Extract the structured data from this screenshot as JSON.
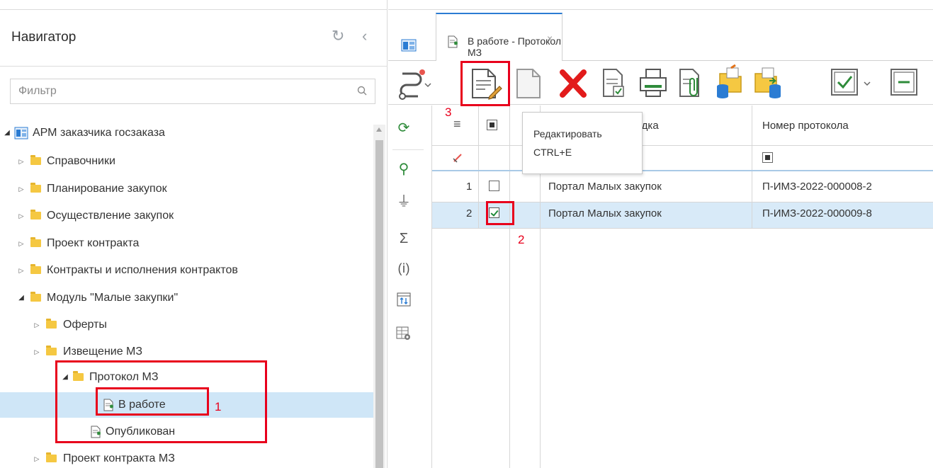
{
  "navigator": {
    "title": "Навигатор",
    "filter_placeholder": "Фильтр",
    "tree": [
      {
        "label": "АРМ заказчика госзаказа",
        "level": 0,
        "expanded": true,
        "icon": "app-icon"
      },
      {
        "label": "Справочники",
        "level": 1,
        "expanded": false,
        "icon": "folder-icon"
      },
      {
        "label": "Планирование закупок",
        "level": 1,
        "expanded": false,
        "icon": "folder-icon"
      },
      {
        "label": "Осуществление закупок",
        "level": 1,
        "expanded": false,
        "icon": "folder-icon"
      },
      {
        "label": "Проект контракта",
        "level": 1,
        "expanded": false,
        "icon": "folder-icon"
      },
      {
        "label": "Контракты и исполнения контрактов",
        "level": 1,
        "expanded": false,
        "icon": "folder-icon"
      },
      {
        "label": "Модуль \"Малые закупки\"",
        "level": 1,
        "expanded": true,
        "icon": "folder-icon"
      },
      {
        "label": "Оферты",
        "level": 2,
        "expanded": false,
        "icon": "folder-icon"
      },
      {
        "label": "Извещение МЗ",
        "level": 2,
        "expanded": false,
        "icon": "folder-icon"
      },
      {
        "label": "Протокол МЗ",
        "level": 2,
        "expanded": true,
        "icon": "folder-icon"
      },
      {
        "label": "В работе",
        "level": 3,
        "selected": true,
        "icon": "document-edit-icon"
      },
      {
        "label": "Опубликован",
        "level": 3,
        "icon": "document-edit-icon"
      },
      {
        "label": "Проект контракта МЗ",
        "level": 2,
        "expanded": false,
        "icon": "folder-icon"
      }
    ]
  },
  "tab": {
    "label": "В работе - Протокол МЗ",
    "close": "×"
  },
  "toolbar": {
    "items": [
      "workflow-icon",
      "edit-document-icon",
      "new-document-icon",
      "delete-icon",
      "approve-document-icon",
      "print-icon",
      "attach-icon",
      "import-icon",
      "export-icon",
      "check-all-icon",
      "uncheck-all-icon"
    ]
  },
  "tooltip": {
    "line1": "Редактировать",
    "line2": "CTRL+E"
  },
  "grid": {
    "columns": [
      "",
      "",
      "щадка",
      "Номер протокола"
    ],
    "filter_row_num_icon": "filter-clear-icon",
    "rows": [
      {
        "num": "1",
        "checked": false,
        "platform": "Портал Малых закупок",
        "protocol": "П-ИМЗ-2022-000008-2"
      },
      {
        "num": "2",
        "checked": true,
        "platform": "Портал Малых закупок",
        "protocol": "П-ИМЗ-2022-000009-8"
      }
    ]
  },
  "annotations": {
    "step1": "1",
    "step2": "2",
    "step3": "3",
    "color": "#e8001c"
  },
  "colors": {
    "selection": "#cfe6f7",
    "accent": "#2b7cd3",
    "folder": "#f5c842"
  }
}
